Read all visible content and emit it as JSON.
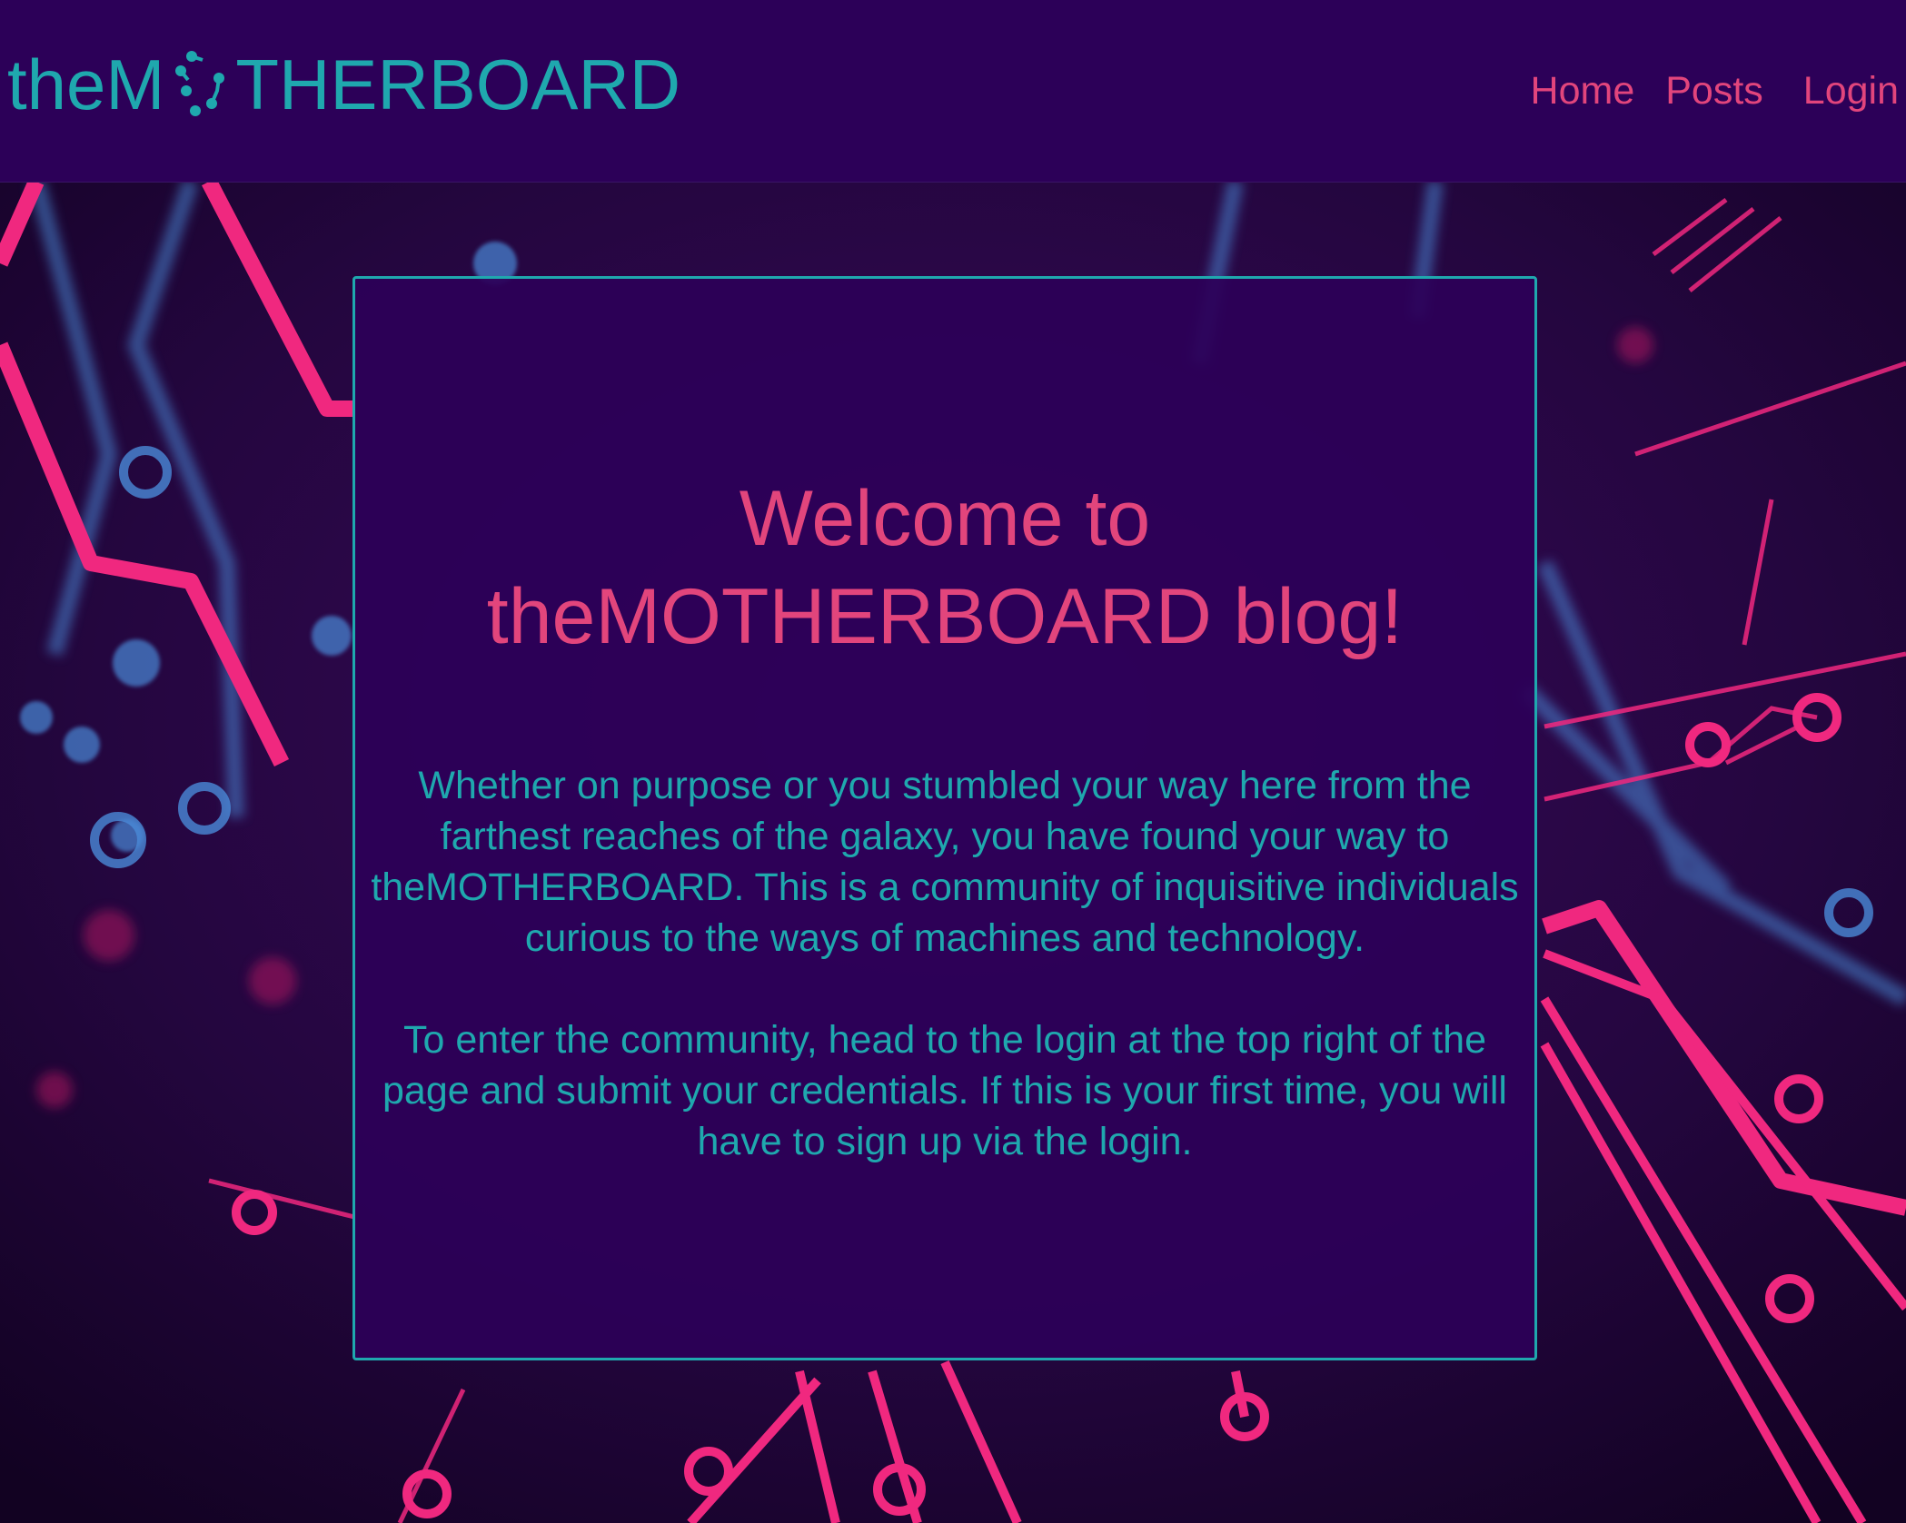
{
  "header": {
    "logo_prefix": "theM",
    "logo_suffix": "THERBOARD",
    "logo_icon": "circuit-o-icon",
    "nav": {
      "home": "Home",
      "posts": "Posts",
      "login": "Login"
    }
  },
  "main": {
    "welcome_title": "Welcome to theMOTHERBOARD blog!",
    "paragraph_1": "Whether on purpose or you stumbled your way here from the farthest reaches of the galaxy, you have found your way to theMOTHERBOARD. This is a community of inquisitive individuals curious to the ways of machines and technology.",
    "paragraph_2": "To enter the community, head to the login at the top right of the page and submit your credentials. If this is your first time, you will have to sign up via the login."
  },
  "colors": {
    "header_bg": "#2c0058",
    "accent_teal": "#1fa8ae",
    "accent_pink": "#e2457c",
    "circuit_pink": "#f0287f",
    "circuit_blue": "#4a8ad8"
  },
  "background": {
    "image": "circuit-board-background"
  }
}
